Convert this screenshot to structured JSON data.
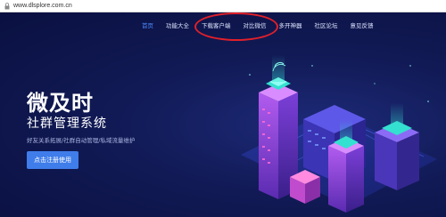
{
  "browser": {
    "url": "www.dlsplore.com.cn"
  },
  "nav": {
    "items": [
      {
        "label": "首页",
        "active": true
      },
      {
        "label": "功能大全",
        "active": false
      },
      {
        "label": "下载客户端",
        "active": false
      },
      {
        "label": "对比微信",
        "active": false
      },
      {
        "label": "多开神器",
        "active": false
      },
      {
        "label": "社区论坛",
        "active": false
      },
      {
        "label": "意见反馈",
        "active": false
      }
    ]
  },
  "hero": {
    "title": "微及时",
    "subtitle": "社群管理系统",
    "description": "好友关系拓展/社群自动管理/私域流量维护",
    "cta_label": "点击注册使用"
  },
  "colors": {
    "background": "#111a55",
    "accent": "#3f7dea",
    "active_nav": "#4d8bff",
    "annotation": "#e0202a"
  }
}
